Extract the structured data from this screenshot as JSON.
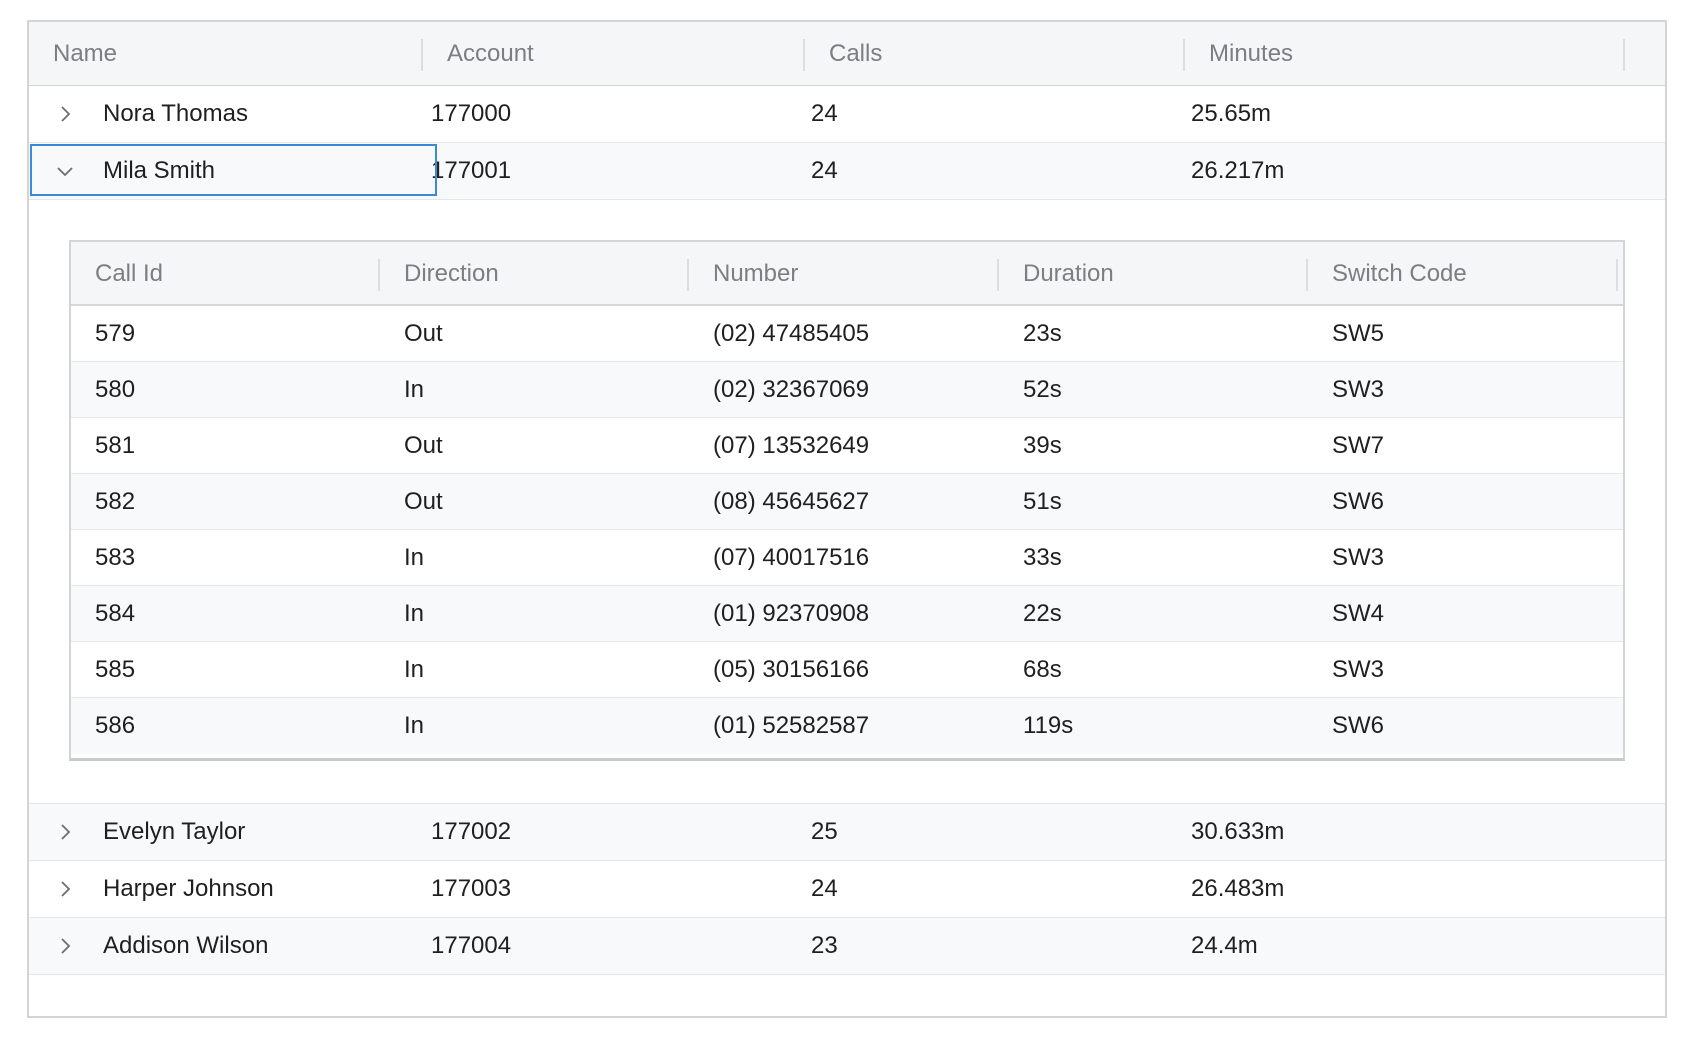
{
  "grid": {
    "columns": [
      "Name",
      "Account",
      "Calls",
      "Minutes"
    ],
    "rows": [
      {
        "name": "Nora Thomas",
        "account": "177000",
        "calls": "24",
        "minutes": "25.65m",
        "expanded": false
      },
      {
        "name": "Mila Smith",
        "account": "177001",
        "calls": "24",
        "minutes": "26.217m",
        "expanded": true
      },
      {
        "name": "Evelyn Taylor",
        "account": "177002",
        "calls": "25",
        "minutes": "30.633m",
        "expanded": false
      },
      {
        "name": "Harper Johnson",
        "account": "177003",
        "calls": "24",
        "minutes": "26.483m",
        "expanded": false
      },
      {
        "name": "Addison Wilson",
        "account": "177004",
        "calls": "23",
        "minutes": "24.4m",
        "expanded": false
      }
    ]
  },
  "detail": {
    "columns": [
      "Call Id",
      "Direction",
      "Number",
      "Duration",
      "Switch Code"
    ],
    "rows": [
      {
        "call_id": "579",
        "direction": "Out",
        "number": "(02) 47485405",
        "duration": "23s",
        "switch_code": "SW5"
      },
      {
        "call_id": "580",
        "direction": "In",
        "number": "(02) 32367069",
        "duration": "52s",
        "switch_code": "SW3"
      },
      {
        "call_id": "581",
        "direction": "Out",
        "number": "(07) 13532649",
        "duration": "39s",
        "switch_code": "SW7"
      },
      {
        "call_id": "582",
        "direction": "Out",
        "number": "(08) 45645627",
        "duration": "51s",
        "switch_code": "SW6"
      },
      {
        "call_id": "583",
        "direction": "In",
        "number": "(07) 40017516",
        "duration": "33s",
        "switch_code": "SW3"
      },
      {
        "call_id": "584",
        "direction": "In",
        "number": "(01) 92370908",
        "duration": "22s",
        "switch_code": "SW4"
      },
      {
        "call_id": "585",
        "direction": "In",
        "number": "(05) 30156166",
        "duration": "68s",
        "switch_code": "SW3"
      },
      {
        "call_id": "586",
        "direction": "In",
        "number": "(01) 52582587",
        "duration": "119s",
        "switch_code": "SW6"
      }
    ]
  },
  "icons": {
    "collapsed": "chevron-right-icon",
    "expanded": "chevron-down-icon"
  },
  "colors": {
    "header_bg": "#f5f6f7",
    "header_text": "#7b7e82",
    "focus_border": "#3b8ad8",
    "alt_row_bg": "#f8f9fb"
  }
}
